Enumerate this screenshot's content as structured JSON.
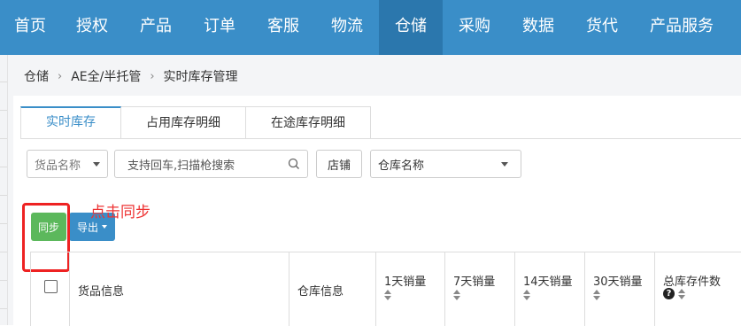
{
  "topnav": {
    "items": [
      "首页",
      "授权",
      "产品",
      "订单",
      "客服",
      "物流",
      "仓储",
      "采购",
      "数据",
      "货代",
      "产品服务"
    ],
    "active_index": 6
  },
  "breadcrumb": [
    "仓储",
    "AE全/半托管",
    "实时库存管理"
  ],
  "tabs": [
    "实时库存",
    "占用库存明细",
    "在途库存明细"
  ],
  "active_tab": 0,
  "filters": {
    "goods_select": "货品名称",
    "search_placeholder": "支持回车,扫描枪搜索",
    "store_button": "店铺",
    "warehouse_select": "仓库名称"
  },
  "toolbar": {
    "sync_label": "同步",
    "export_label": "导出",
    "annotation": "点击同步"
  },
  "table": {
    "headers": [
      "货品信息",
      "仓库信息",
      "1天销量",
      "7天销量",
      "14天销量",
      "30天销量",
      "总库存件数"
    ]
  },
  "colors": {
    "nav_bg": "#3a8ec8",
    "nav_active": "#2b77ad",
    "sync_button": "#5cb85c",
    "export_button": "#3a8ec8",
    "annotation_red": "#ee2222"
  }
}
